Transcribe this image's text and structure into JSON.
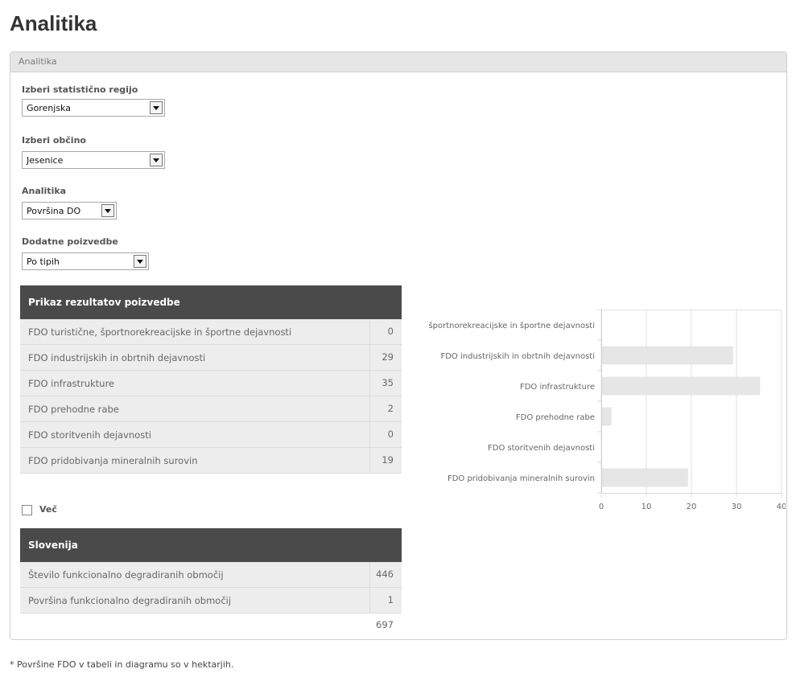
{
  "page_title": "Analitika",
  "panel": {
    "header": "Analitika"
  },
  "form": {
    "region": {
      "label": "Izberi statistično regijo",
      "value": "Gorenjska"
    },
    "municipality": {
      "label": "Izberi občino",
      "value": "Jesenice"
    },
    "analytics": {
      "label": "Analitika",
      "value": "Površina DO"
    },
    "extra": {
      "label": "Dodatne poizvedbe",
      "value": "Po tipih"
    }
  },
  "results": {
    "title": "Prikaz rezultatov poizvedbe",
    "rows": [
      {
        "label": "FDO turistične, športnorekreacijske in športne dejavnosti",
        "value": "0"
      },
      {
        "label": "FDO industrijskih in obrtnih dejavnosti",
        "value": "29"
      },
      {
        "label": "FDO infrastrukture",
        "value": "35"
      },
      {
        "label": "FDO prehodne rabe",
        "value": "2"
      },
      {
        "label": "FDO storitvenih dejavnosti",
        "value": "0"
      },
      {
        "label": "FDO pridobivanja mineralnih surovin",
        "value": "19"
      }
    ]
  },
  "more": {
    "label": "Več",
    "checked": false
  },
  "slovenia": {
    "title": "Slovenija",
    "rows": [
      {
        "label": "Število funkcionalno degradiranih območij",
        "value": "446"
      },
      {
        "label": "Površina funkcionalno degradiranih območij",
        "value": "1 697"
      }
    ]
  },
  "footnote": "* Površine FDO v tabeli in diagramu so v hektarjih.",
  "chart_data": {
    "type": "bar",
    "orientation": "horizontal",
    "categories": [
      "športnorekreacijske in športne dejavnosti",
      "FDO industrijskih in obrtnih dejavnosti",
      "FDO infrastrukture",
      "FDO prehodne rabe",
      "FDO storitvenih dejavnosti",
      "FDO pridobivanja mineralnih surovin"
    ],
    "values": [
      0,
      29,
      35,
      2,
      0,
      19
    ],
    "xlim": [
      0,
      40
    ],
    "xticks": [
      0,
      10,
      20,
      30,
      40
    ],
    "grid": true,
    "bar_color": "#e6e6e6"
  }
}
